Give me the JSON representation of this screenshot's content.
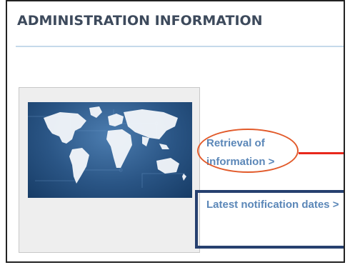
{
  "header": {
    "title": "ADMINISTRATION INFORMATION"
  },
  "card": {
    "image": "world-map-image"
  },
  "links": {
    "retrieval": "Retrieval of information >",
    "latest": "Latest notification dates >"
  },
  "annotations": {
    "oval_color": "#e25a2a",
    "arrow_color": "#e8281c",
    "box_color": "#26406f"
  },
  "colors": {
    "link": "#5b87b8",
    "title": "#3d4a5c",
    "rule": "#c5d9ea"
  }
}
